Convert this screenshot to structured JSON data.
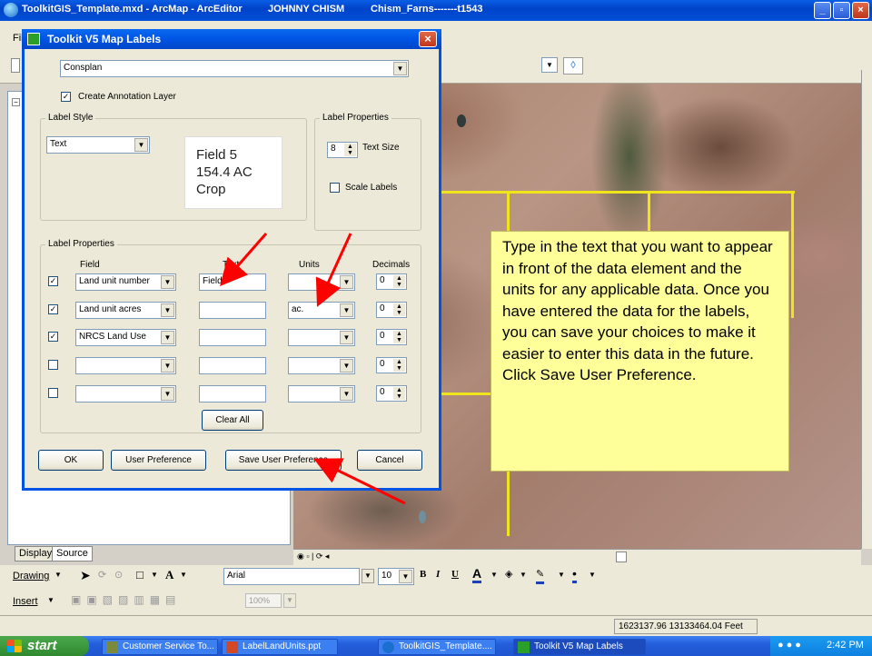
{
  "app": {
    "title": "ToolkitGIS_Template.mxd - ArcMap - ArcEditor",
    "user": "JOHNNY CHISM",
    "document": "Chism_Farns-------t1543",
    "menu_first": "Fil"
  },
  "dialog": {
    "title": "Toolkit V5 Map Labels",
    "layer_select": "Consplan",
    "create_annotation_label": "Create Annotation Layer",
    "create_annotation_checked": true,
    "label_style_group": "Label Style",
    "label_style_value": "Text",
    "preview_lines": [
      "Field 5",
      "154.4 AC",
      "Crop"
    ],
    "text_props_group": "Label Properties",
    "text_size_value": "8",
    "text_size_label": "Text Size",
    "scale_labels_label": "Scale Labels",
    "scale_labels_checked": false,
    "label_props_group": "Label Properties",
    "columns": {
      "field": "Field",
      "text": "Text",
      "units": "Units",
      "decimals": "Decimals"
    },
    "rows": [
      {
        "checked": true,
        "field": "Land unit number",
        "text": "Field",
        "units": "",
        "decimals": "0"
      },
      {
        "checked": true,
        "field": "Land unit acres",
        "text": "",
        "units": "ac.",
        "decimals": "0"
      },
      {
        "checked": true,
        "field": "NRCS Land Use",
        "text": "",
        "units": "",
        "decimals": "0"
      },
      {
        "checked": false,
        "field": "",
        "text": "",
        "units": "",
        "decimals": "0"
      },
      {
        "checked": false,
        "field": "",
        "text": "",
        "units": "",
        "decimals": "0"
      }
    ],
    "clear_all": "Clear All",
    "ok": "OK",
    "user_preference": "User Preference",
    "save_user_preference": "Save User Preference",
    "cancel": "Cancel"
  },
  "callout": {
    "text": "Type in the text that you want to appear in front of the data element and the units for any applicable data. Once you have entered the data for the labels, you can save your choices to make it easier to enter this data in the future. Click Save User Preference."
  },
  "toc": {
    "tab_display": "Display",
    "tab_source": "Source"
  },
  "drawing_toolbar": {
    "drawing": "Drawing",
    "font": "Arial",
    "font_size": "10",
    "insert": "Insert",
    "zoom": "100%"
  },
  "status": {
    "coordinates": "1623137.96  13133464.04 Feet"
  },
  "taskbar": {
    "start": "start",
    "items": [
      "Customer Service To...",
      "LabelLandUnits.ppt",
      "ToolkitGIS_Template....",
      "Toolkit V5 Map Labels"
    ],
    "clock": "2:42 PM"
  },
  "colors": {
    "title_blue": "#0054e3",
    "callout_yellow": "#ffff99",
    "arrow_red": "#ff0000",
    "field_lines": "#f0e41c"
  },
  "icons": [
    "app-globe-icon",
    "minimize-icon",
    "maximize-icon",
    "close-icon",
    "dropdown-arrow-icon",
    "spin-icon",
    "start-flag-icon"
  ]
}
